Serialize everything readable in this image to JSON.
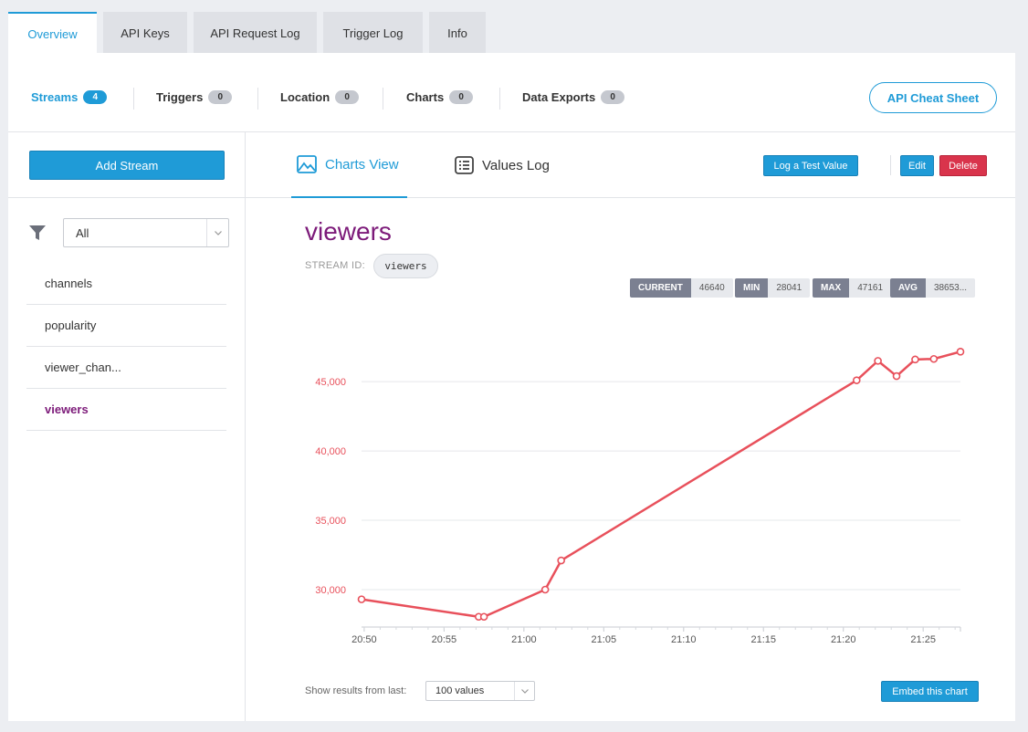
{
  "tabs": [
    "Overview",
    "API Keys",
    "API Request Log",
    "Trigger Log",
    "Info"
  ],
  "summary": {
    "items": [
      {
        "label": "Streams",
        "count": "4"
      },
      {
        "label": "Triggers",
        "count": "0"
      },
      {
        "label": "Location",
        "count": "0"
      },
      {
        "label": "Charts",
        "count": "0"
      },
      {
        "label": "Data Exports",
        "count": "0"
      }
    ],
    "cheat_sheet": "API Cheat Sheet"
  },
  "sidebar": {
    "add_stream": "Add Stream",
    "filter_value": "All",
    "streams": [
      "channels",
      "popularity",
      "viewer_chan...",
      "viewers"
    ]
  },
  "main": {
    "view_tabs": [
      "Charts View",
      "Values Log"
    ],
    "log_test": "Log a Test Value",
    "edit": "Edit",
    "delete": "Delete",
    "stream_title": "viewers",
    "stream_id_label": "STREAM ID:",
    "stream_id": "viewers",
    "stats": [
      {
        "k": "CURRENT",
        "v": "46640"
      },
      {
        "k": "MIN",
        "v": "28041"
      },
      {
        "k": "MAX",
        "v": "47161"
      },
      {
        "k": "AVG",
        "v": "38653..."
      }
    ],
    "results_label": "Show results from last:",
    "results_value": "100 values",
    "embed": "Embed this chart"
  },
  "chart_data": {
    "type": "line",
    "x_ticks": [
      "20:50",
      "20:55",
      "21:00",
      "21:05",
      "21:10",
      "21:15",
      "21:20",
      "21:25"
    ],
    "y_ticks": [
      "30,000",
      "35,000",
      "40,000",
      "45,000"
    ],
    "y_tick_values": [
      30000,
      35000,
      40000,
      45000
    ],
    "xlim": [
      "20:49:50",
      "21:27:20"
    ],
    "ylim": [
      27300,
      48500
    ],
    "x": [
      "20:49:50",
      "20:57:10",
      "20:57:30",
      "21:01:20",
      "21:02:20",
      "21:20:50",
      "21:22:10",
      "21:23:20",
      "21:24:30",
      "21:25:40",
      "21:27:20"
    ],
    "values": [
      29300,
      28041,
      28041,
      30000,
      32100,
      45100,
      46500,
      45400,
      46600,
      46640,
      47161
    ],
    "color": "#e8505b"
  }
}
